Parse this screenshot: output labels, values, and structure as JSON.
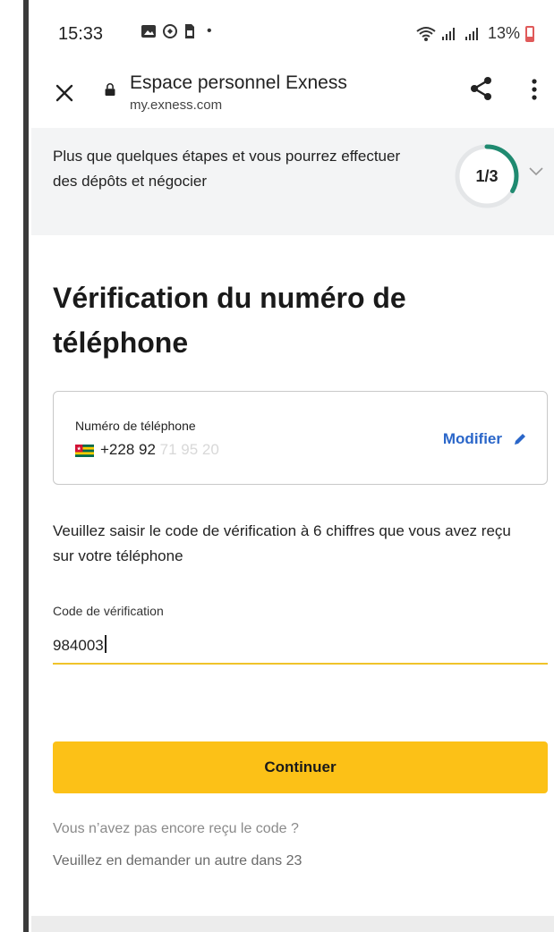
{
  "status_bar": {
    "time": "15:33",
    "battery": "13%",
    "battery_color": "#e05a5a"
  },
  "browser": {
    "title": "Espace personnel Exness",
    "url": "my.exness.com",
    "icons": [
      "close-icon",
      "lock-icon",
      "share-icon",
      "more-vert-icon"
    ]
  },
  "banner": {
    "text": "Plus que quelques étapes et vous pourrez effectuer des dépôts et négocier",
    "step": "1/3",
    "progress_fraction": 0.333,
    "accent_color": "#1f8a70"
  },
  "main": {
    "heading": "Vérification du numéro de téléphone",
    "phone": {
      "label": "Numéro de téléphone",
      "number_visible": "+228 92",
      "number_faded": "71 95 20",
      "modify_label": "Modifier",
      "link_color": "#2a66c9"
    },
    "instructions": "Veuillez saisir le code de vérification à 6 chiffres que vous avez reçu sur votre téléphone",
    "code": {
      "label": "Code de vérification",
      "value": "984003",
      "underline_color": "#f0c32a"
    },
    "continue_label": "Continuer",
    "button_color": "#fcc117",
    "resend_question": "Vous n’avez pas encore reçu le code ?",
    "resend_timer": "Veuillez en demander un autre dans 23"
  }
}
